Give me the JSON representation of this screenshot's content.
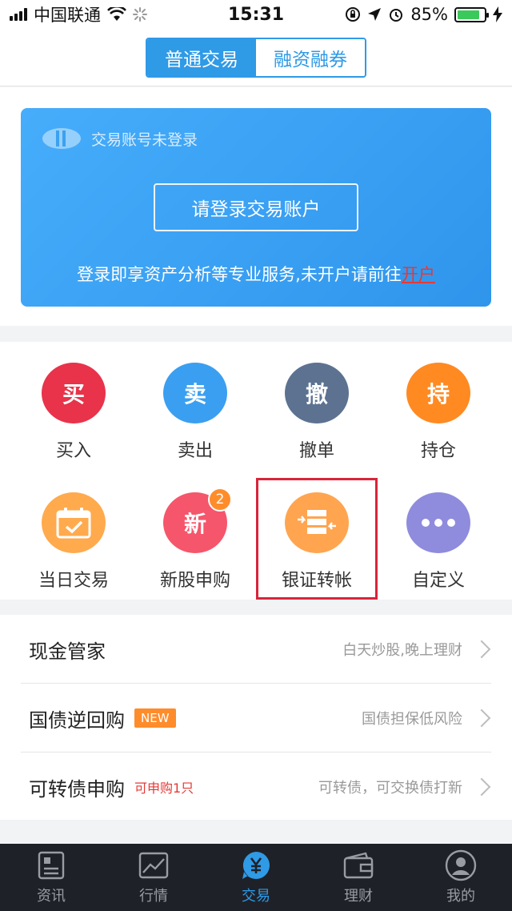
{
  "status_bar": {
    "carrier": "中国联通",
    "time": "15:31",
    "battery_percent": "85%",
    "battery_level": 0.85
  },
  "header": {
    "tabs": [
      {
        "label": "普通交易",
        "active": true
      },
      {
        "label": "融资融券",
        "active": false
      }
    ]
  },
  "login_card": {
    "account_status": "交易账号未登录",
    "login_button": "请登录交易账户",
    "tip_text": "登录即享资产分析等专业服务,未开户请前往",
    "open_account_link": "开户"
  },
  "functions": [
    {
      "icon_text": "买",
      "label": "买入",
      "color": "#e8334a"
    },
    {
      "icon_text": "卖",
      "label": "卖出",
      "color": "#3a9ff0"
    },
    {
      "icon_text": "撤",
      "label": "撤单",
      "color": "#5c7290"
    },
    {
      "icon_text": "持",
      "label": "持仓",
      "color": "#ff8a22"
    },
    {
      "icon_name": "calendar-check-icon",
      "label": "当日交易",
      "color": "#ffaa4d"
    },
    {
      "icon_text": "新",
      "label": "新股申购",
      "color": "#f5566b",
      "badge": "2"
    },
    {
      "icon_name": "bank-transfer-icon",
      "label": "银证转帐",
      "color": "#ffa550"
    },
    {
      "icon_name": "more-dots-icon",
      "label": "自定义",
      "color": "#8f8cdd"
    }
  ],
  "list_items": [
    {
      "title": "现金管家",
      "desc": "白天炒股,晚上理财"
    },
    {
      "title": "国债逆回购",
      "tag": "NEW",
      "desc": "国债担保低风险"
    },
    {
      "title": "可转债申购",
      "tag": "可申购1只",
      "desc": "可转债，可交换债打新"
    }
  ],
  "tabbar": [
    {
      "label": "资讯",
      "icon": "news-icon",
      "active": false
    },
    {
      "label": "行情",
      "icon": "chart-icon",
      "active": false
    },
    {
      "label": "交易",
      "icon": "yuan-icon",
      "active": true
    },
    {
      "label": "理财",
      "icon": "wallet-icon",
      "active": false
    },
    {
      "label": "我的",
      "icon": "user-icon",
      "active": false
    }
  ]
}
